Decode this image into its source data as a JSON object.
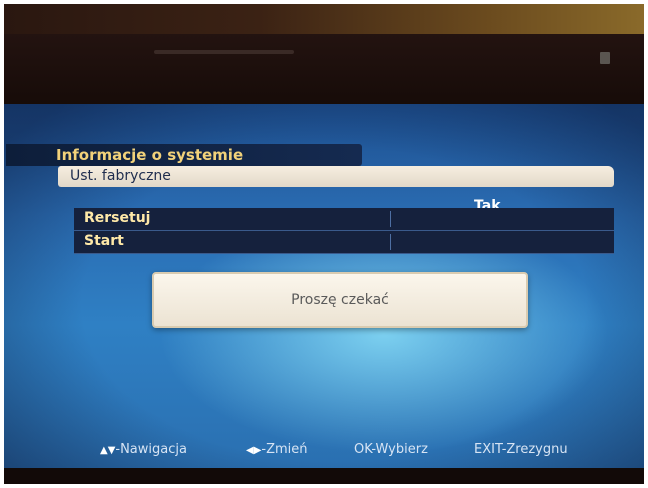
{
  "menu": {
    "title": "Informacje o systemie",
    "selected_option": "Ust. fabryczne",
    "value_header": "Tak",
    "items": [
      {
        "label": "Rersetuj"
      },
      {
        "label": "Start"
      }
    ]
  },
  "dialog": {
    "message": "Proszę czekać"
  },
  "footer": {
    "hints": [
      {
        "keys": "▲▼",
        "text": "-Nawigacja"
      },
      {
        "keys": "◀▶",
        "text": "-Zmień"
      },
      {
        "keys": "",
        "text": "OK-Wybierz"
      },
      {
        "keys": "",
        "text": "EXIT-Zrezygnu"
      }
    ]
  },
  "colors": {
    "screen_blue": "#2a6cb2",
    "title_text": "#f2d27a",
    "item_text": "#ffe9a8",
    "panel_dark": "#15213d",
    "dialog_bg": "#f4ecdd"
  }
}
